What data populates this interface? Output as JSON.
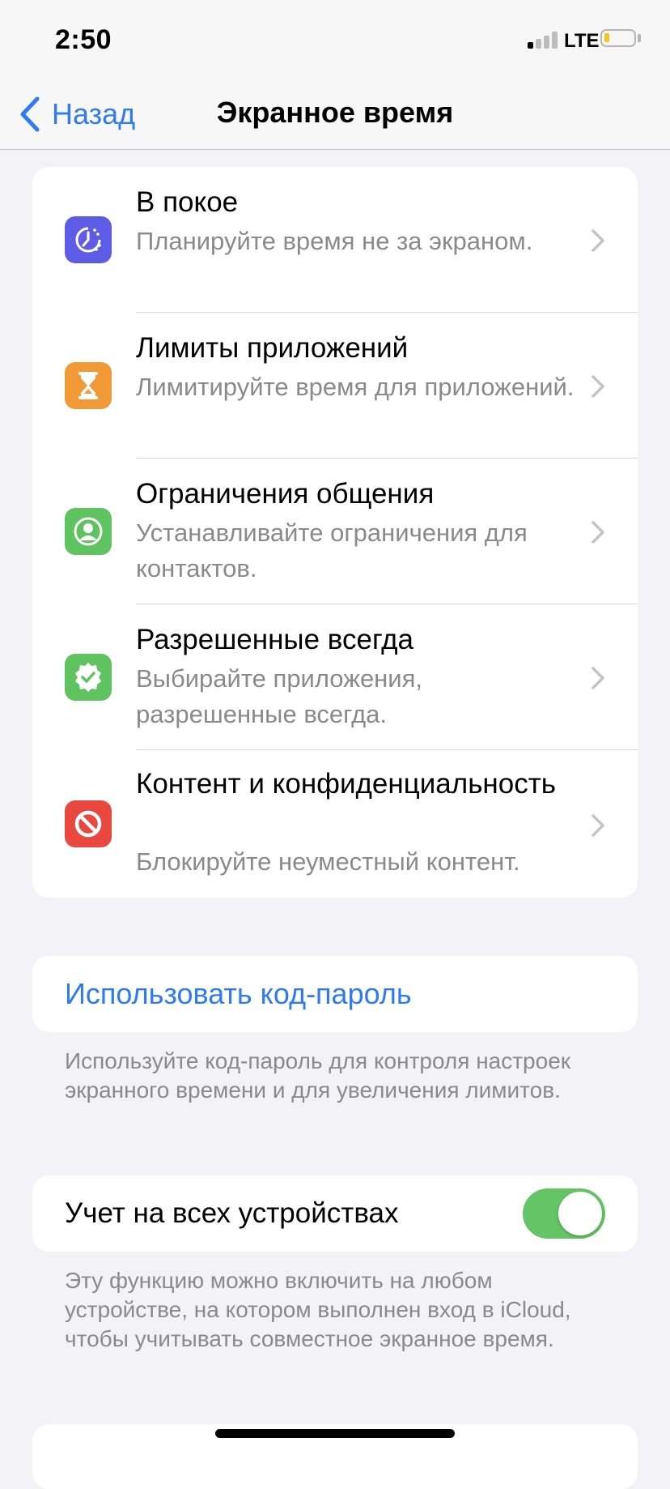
{
  "status": {
    "time": "2:50",
    "network": "LTE"
  },
  "nav": {
    "back_label": "Назад",
    "title": "Экранное время"
  },
  "settings": [
    {
      "title": "В покое",
      "subtitle": "Планируйте время не за экраном.",
      "icon": "downtime-icon",
      "color": "#5e5ce6"
    },
    {
      "title": "Лимиты приложений",
      "subtitle": "Лимитируйте время для приложений.",
      "icon": "hourglass-icon",
      "color": "#f19a37"
    },
    {
      "title": "Ограничения общения",
      "subtitle": "Устанавливайте ограничения для контактов.",
      "icon": "contact-icon",
      "color": "#5fc45f"
    },
    {
      "title": "Разрешенные всегда",
      "subtitle": "Выбирайте приложения, разрешенные всегда.",
      "icon": "checkmark-badge-icon",
      "color": "#5fc45f"
    },
    {
      "title": "Контент и конфиденциальность",
      "subtitle": "Блокируйте неуместный контент.",
      "icon": "restriction-icon",
      "color": "#e9483f"
    }
  ],
  "passcode": {
    "label": "Использовать код-пароль",
    "footnote": "Используйте код-пароль для контроля настроек экранного времени и для увеличения лимитов."
  },
  "share": {
    "label": "Учет на всех устройствах",
    "enabled": true,
    "footnote": "Эту функцию можно включить на любом устройстве, на котором выполнен вход в iCloud, чтобы учитывать совместное экранное время."
  },
  "colors": {
    "accent": "#2f7bf5",
    "toggle_on": "#65c466"
  }
}
